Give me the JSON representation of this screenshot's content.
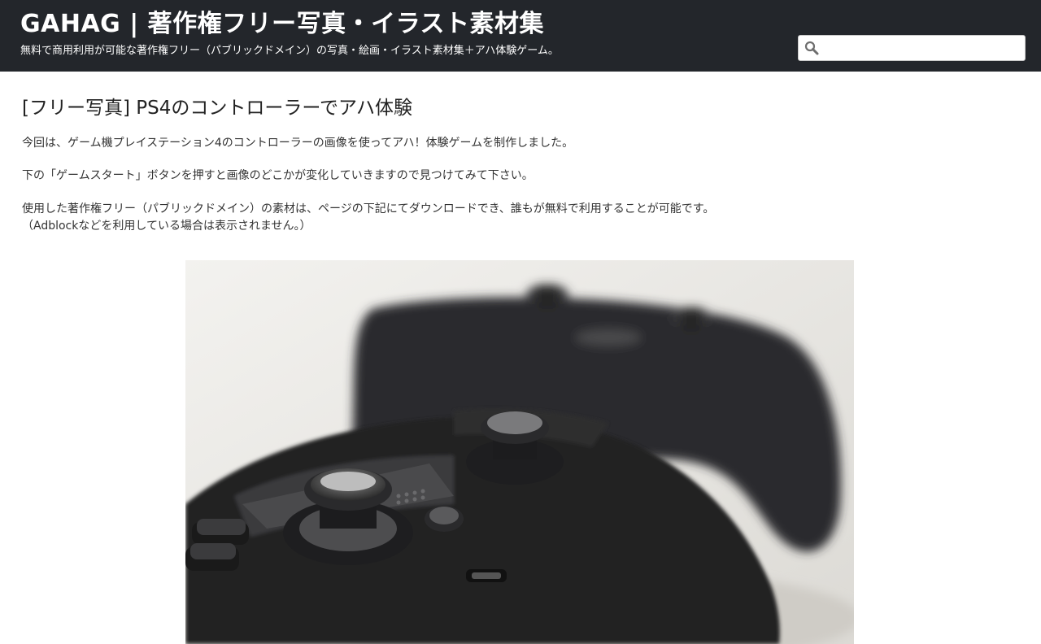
{
  "header": {
    "site_title": "GAHAG | 著作権フリー写真・イラスト素材集",
    "site_description": "無料で商用利用が可能な著作権フリー（パブリックドメイン）の写真・絵画・イラスト素材集＋アハ体験ゲーム。",
    "search": {
      "value": "",
      "placeholder": "",
      "icon": "search-icon"
    },
    "background_color": "#23262b"
  },
  "article": {
    "title": "[フリー写真] PS4のコントローラーでアハ体験",
    "paragraphs": [
      "今回は、ゲーム機プレイステーション4のコントローラーの画像を使ってアハ！体験ゲームを制作しました。",
      "下の「ゲームスタート」ボタンを押すと画像のどこかが変化していきますので見つけてみて下さい。",
      "使用した著作権フリー（パブリックドメイン）の素材は、ページの下記にてダウンロードでき、誰もが無料で利用することが可能です。",
      "（Adblockなどを利用している場合は表示されません。）"
    ],
    "image": {
      "subject": "playstation-4-controllers-photo"
    }
  }
}
